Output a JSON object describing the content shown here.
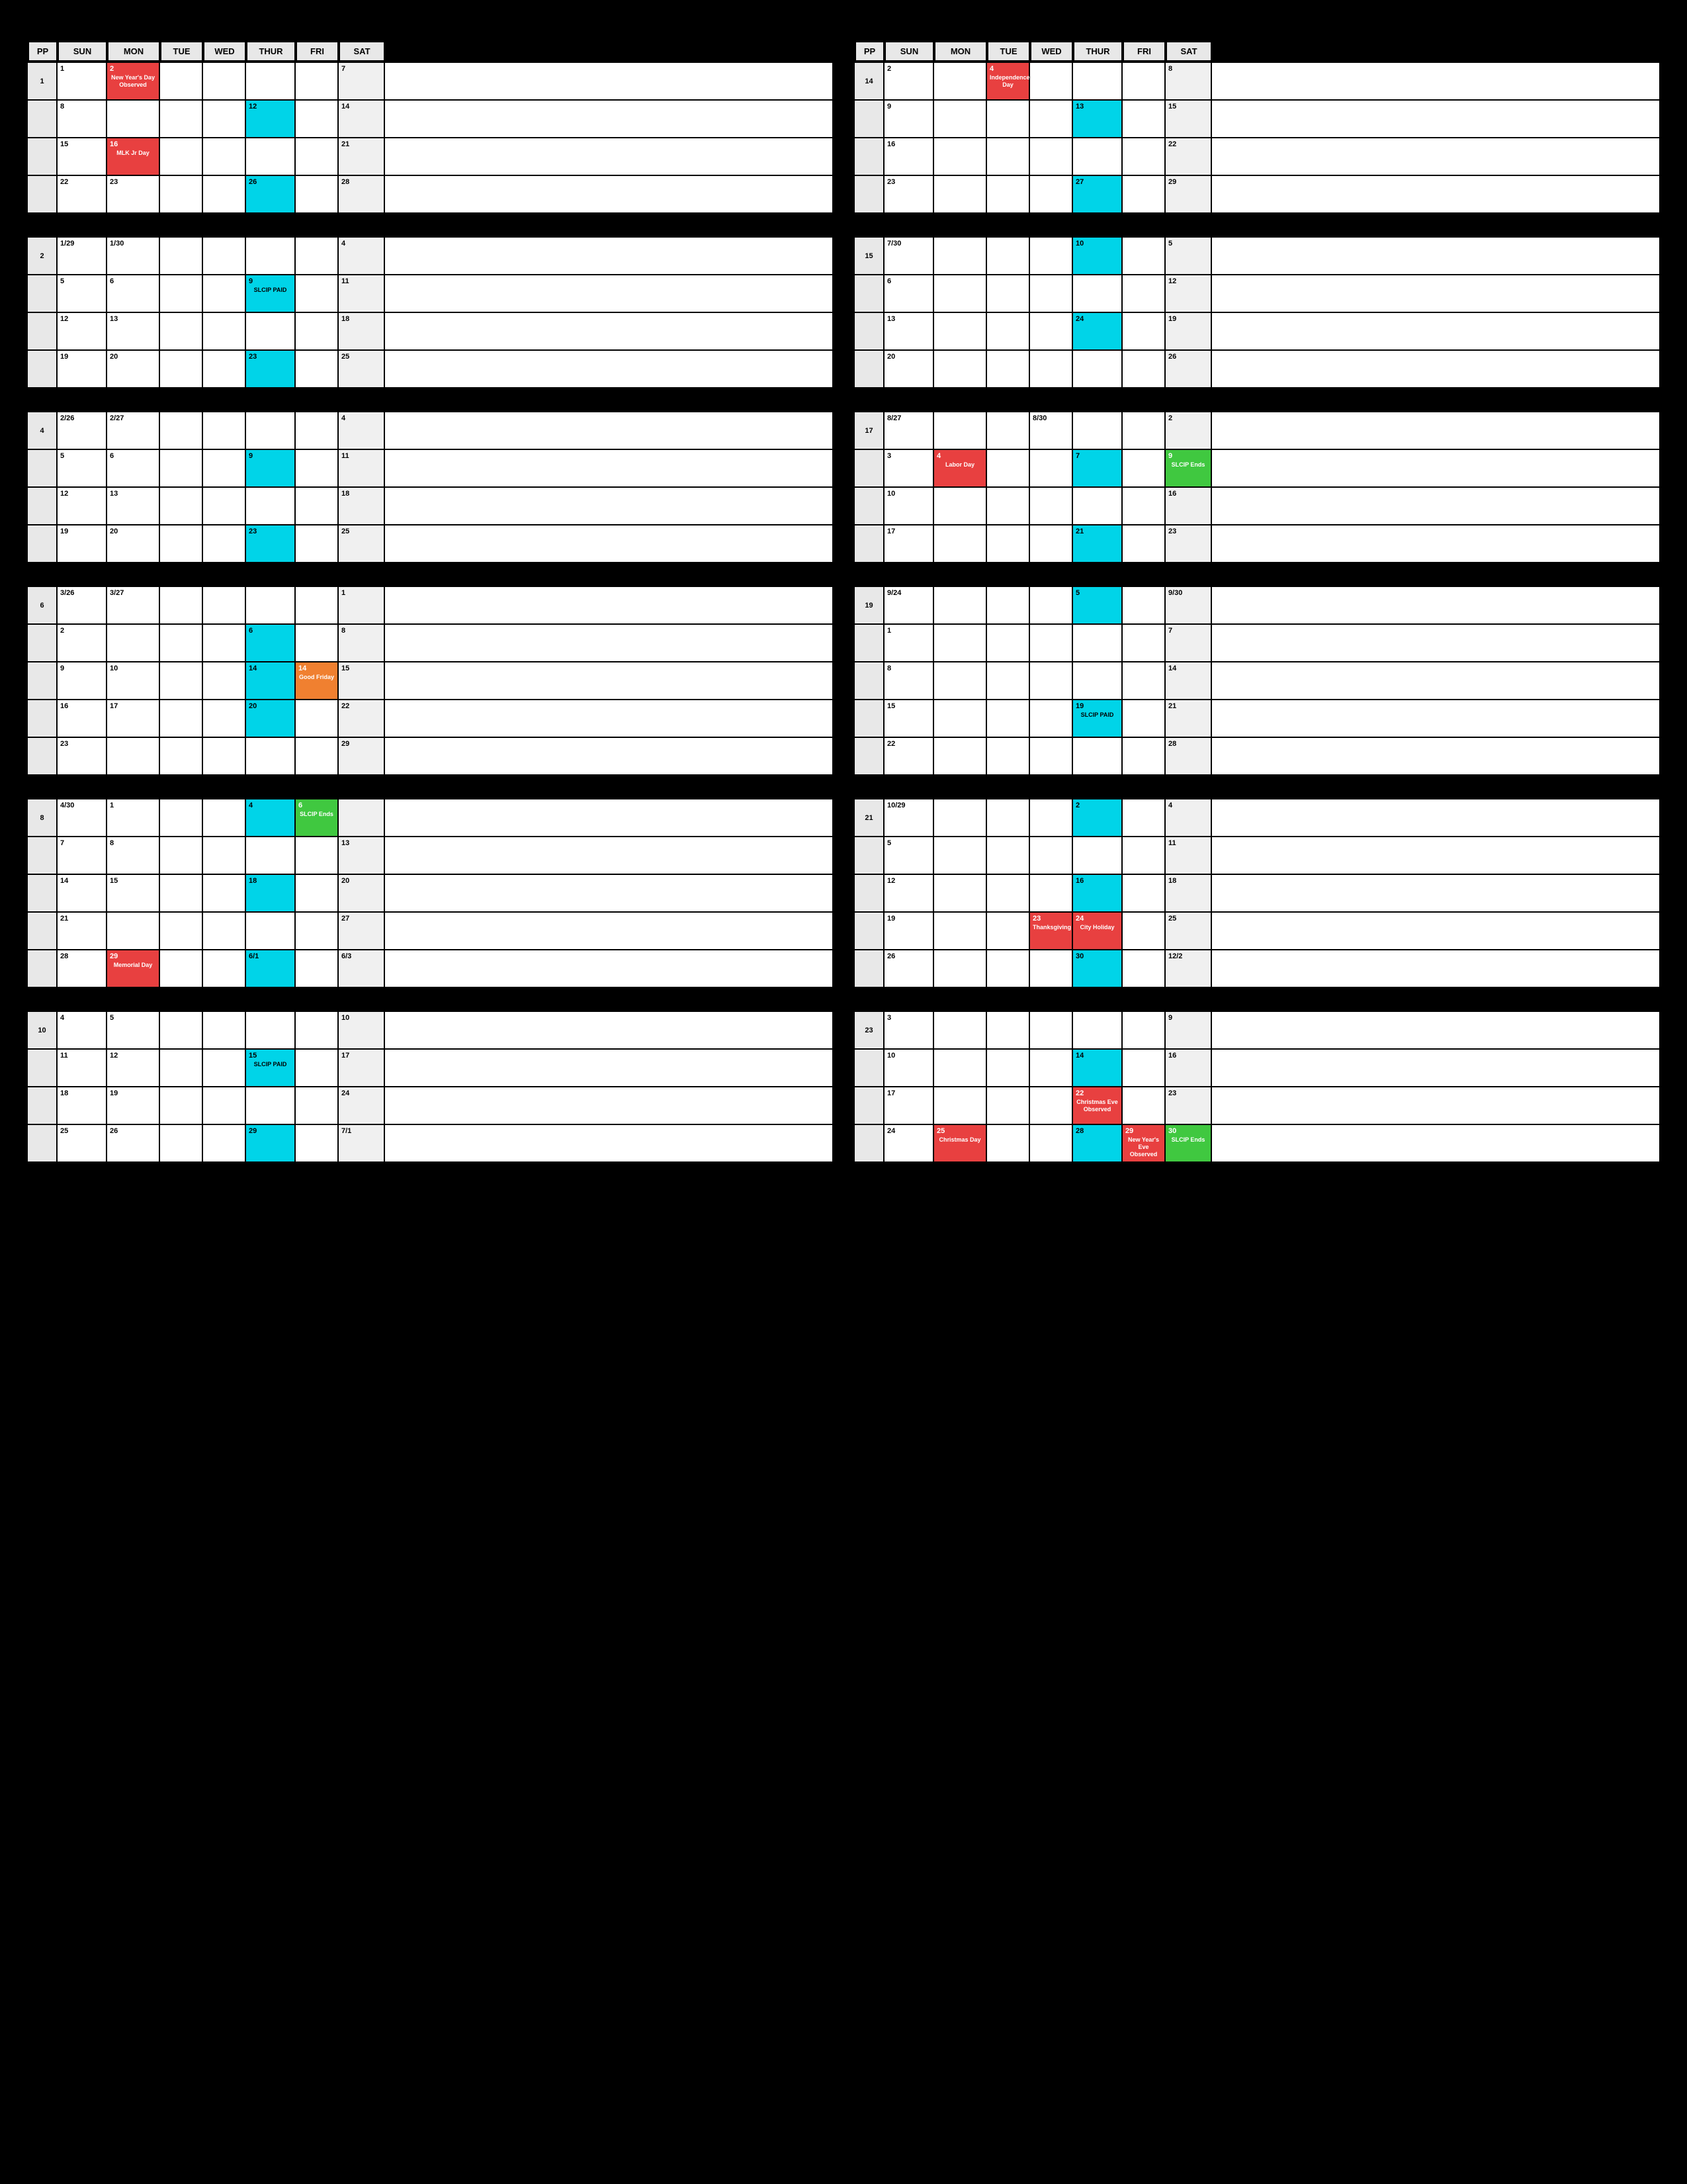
{
  "calendars": {
    "left": {
      "headers": [
        "PP",
        "SUN",
        "MON",
        "TUE",
        "WED",
        "THUR",
        "FRI",
        "SAT"
      ],
      "periods": [
        {
          "pp": "1",
          "rows": [
            [
              "1",
              "2\nNew Year's Day\nObserved",
              "",
              "",
              "",
              "",
              "7",
              ""
            ],
            [
              "8",
              "",
              "",
              "",
              "12",
              "",
              "14",
              ""
            ],
            [
              "15",
              "16\nMLK Jr\nDay",
              "",
              "",
              "",
              "",
              "21",
              ""
            ],
            [
              "22",
              "23",
              "",
              "",
              "26",
              "",
              "28",
              ""
            ]
          ],
          "highlights": {
            "1_mon": "red",
            "3_mon": "red",
            "2_thur": "cyan",
            "4_thur": "cyan"
          }
        }
      ]
    }
  }
}
